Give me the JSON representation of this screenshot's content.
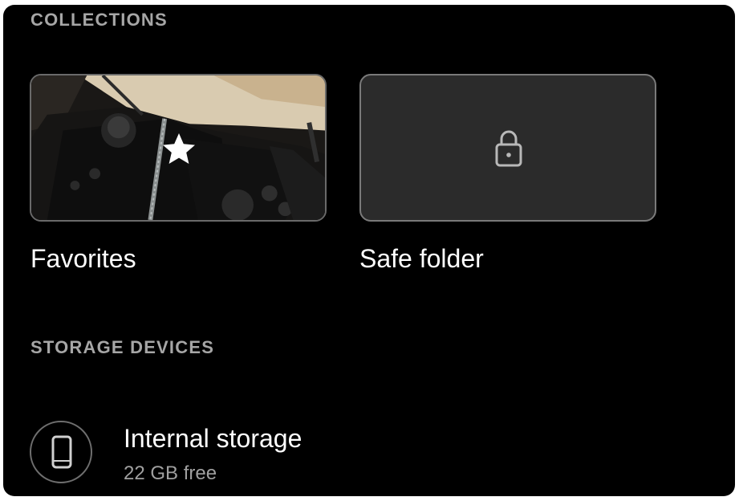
{
  "collections": {
    "section_label": "COLLECTIONS",
    "items": [
      {
        "label": "Favorites",
        "icon": "star-icon"
      },
      {
        "label": "Safe folder",
        "icon": "lock-icon"
      }
    ]
  },
  "storage": {
    "section_label": "STORAGE DEVICES",
    "devices": [
      {
        "name": "Internal storage",
        "free": "22 GB free",
        "icon": "phone-icon"
      }
    ]
  },
  "colors": {
    "background": "#000000",
    "section_label": "#a6a6a6",
    "tile_fill": "#2b2b2b",
    "tile_border": "#6a6a6a",
    "text_primary": "#ffffff",
    "text_secondary": "#a0a0a0"
  }
}
